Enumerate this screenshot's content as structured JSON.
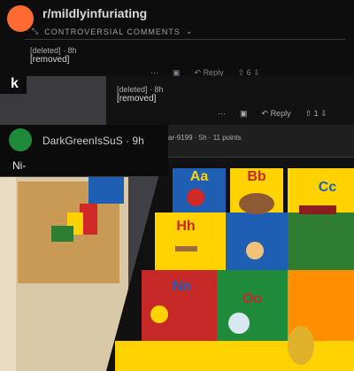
{
  "header": {
    "subreddit": "r/mildlyinfuriating",
    "sort_label": "CONTROVERSIAL COMMENTS"
  },
  "comment1": {
    "author": "[deleted]",
    "age": "8h",
    "body": "[removed]",
    "actions": {
      "reply": "Reply",
      "score": "6"
    }
  },
  "comment2": {
    "author": "[deleted]",
    "age": "8h",
    "body": "[removed]",
    "actions": {
      "reply": "Reply",
      "score": "1"
    }
  },
  "left_fragment": "k",
  "comment3": {
    "author": "DarkGreenIsSuS",
    "age": "9h",
    "body": "Ni-"
  },
  "strip_meta": "ar-9199 · 5h · 11 points",
  "mat": {
    "tiles": [
      {
        "letter": "Aa",
        "color": "#1e5fb4",
        "letter_color": "#ffd200"
      },
      {
        "letter": "Bb",
        "color": "#ffd200",
        "letter_color": "#c62828"
      },
      {
        "letter": "Cc",
        "color": "#ffd200",
        "letter_color": "#1e5fb4"
      },
      {
        "letter": "Hh",
        "color": "#ffd200",
        "letter_color": "#c62828"
      },
      {
        "letter": "Ii",
        "color": "#1e5fb4",
        "letter_color": "#ffd200"
      },
      {
        "letter": "Nn",
        "color": "#c62828",
        "letter_color": "#1e5fb4"
      },
      {
        "letter": "Oo",
        "color": "#1f8a3a",
        "letter_color": "#c62828"
      }
    ]
  }
}
